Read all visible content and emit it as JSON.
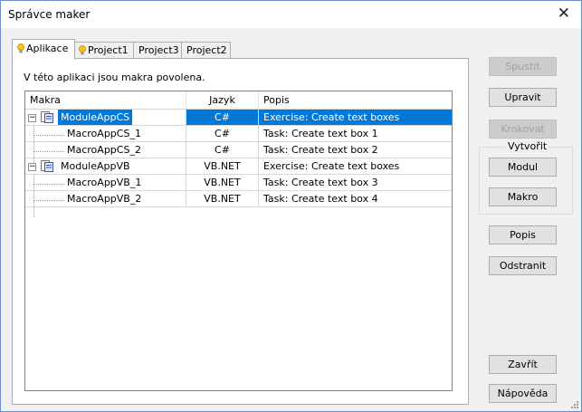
{
  "window": {
    "title": "Správce maker",
    "close_glyph": "✕"
  },
  "tabs": [
    {
      "label": "Aplikace",
      "icon": "lightbulb-icon",
      "active": true
    },
    {
      "label": "Project1",
      "icon": "lightbulb-icon",
      "active": false
    },
    {
      "label": "Project3",
      "active": false
    },
    {
      "label": "Project2",
      "active": false
    }
  ],
  "panel": {
    "info_text": "V této aplikaci jsou makra povolena."
  },
  "list": {
    "columns": [
      "Makra",
      "Jazyk",
      "Popis"
    ],
    "rows": [
      {
        "name": "ModuleAppCS",
        "language": "C#",
        "description": "Exercise: Create text boxes",
        "level": 0,
        "expander": "−",
        "selected": true
      },
      {
        "name": "MacroAppCS_1",
        "language": "C#",
        "description": "Task: Create text box 1",
        "level": 1
      },
      {
        "name": "MacroAppCS_2",
        "language": "C#",
        "description": "Task: Create text box 2",
        "level": 1
      },
      {
        "name": "ModuleAppVB",
        "language": "VB.NET",
        "description": "Exercise: Create text boxes",
        "level": 0,
        "expander": "−"
      },
      {
        "name": "MacroAppVB_1",
        "language": "VB.NET",
        "description": "Task: Create text box 3",
        "level": 1
      },
      {
        "name": "MacroAppVB_2",
        "language": "VB.NET",
        "description": "Task: Create text box 4",
        "level": 1
      }
    ]
  },
  "buttons": {
    "run": "Spustit",
    "edit": "Upravit",
    "step": "Krokovat",
    "create_group": "Vytvořit",
    "module": "Modul",
    "macro": "Makro",
    "description": "Popis",
    "remove": "Odstranit",
    "close": "Zavřít",
    "help": "Nápověda"
  },
  "colors": {
    "selection": "#0078d7",
    "bulb": "#f5c518"
  }
}
